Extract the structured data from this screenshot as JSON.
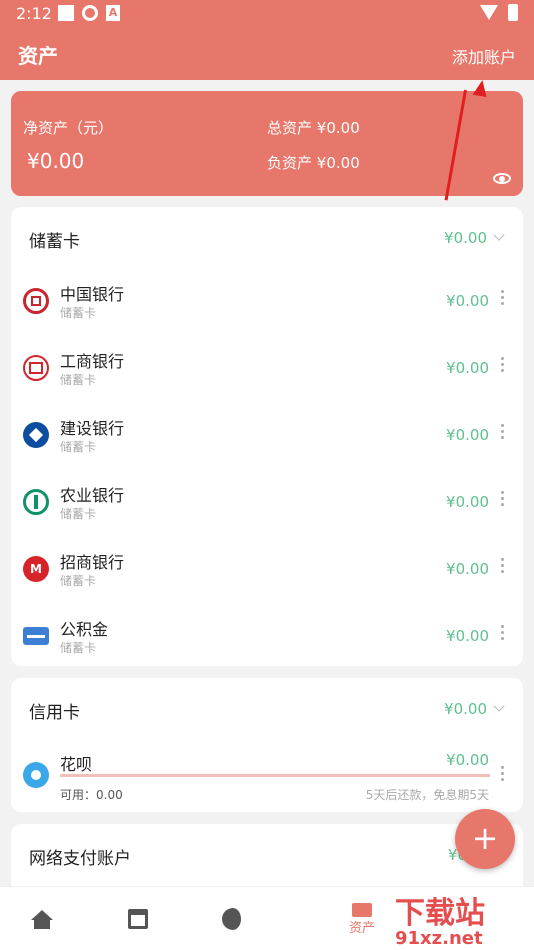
{
  "status_bar": {
    "time": "2:12"
  },
  "app_bar": {
    "title": "资产",
    "add_account": "添加账户"
  },
  "summary": {
    "net_label": "净资产（元）",
    "net_value": "¥0.00",
    "total_label": "总资产",
    "total_value": "¥0.00",
    "debt_label": "负资产",
    "debt_value": "¥0.00"
  },
  "savings": {
    "title": "储蓄卡",
    "total": "¥0.00",
    "items": [
      {
        "name": "中国银行",
        "type": "储蓄卡",
        "value": "¥0.00"
      },
      {
        "name": "工商银行",
        "type": "储蓄卡",
        "value": "¥0.00"
      },
      {
        "name": "建设银行",
        "type": "储蓄卡",
        "value": "¥0.00"
      },
      {
        "name": "农业银行",
        "type": "储蓄卡",
        "value": "¥0.00"
      },
      {
        "name": "招商银行",
        "type": "储蓄卡",
        "value": "¥0.00"
      },
      {
        "name": "公积金",
        "type": "储蓄卡",
        "value": "¥0.00"
      }
    ]
  },
  "credit": {
    "title": "信用卡",
    "total": "¥0.00",
    "item": {
      "name": "花呗",
      "value": "¥0.00",
      "available": "可用：0.00",
      "note": "5天后还款，免息期5天"
    }
  },
  "online": {
    "title": "网络支付账户",
    "total": "¥0"
  },
  "nav": {
    "assets_label": "资产"
  },
  "watermark": {
    "line1": "下载站",
    "line2": "91xz.net"
  },
  "colors": {
    "accent": "#e8776b",
    "money": "#5fbf8f"
  }
}
